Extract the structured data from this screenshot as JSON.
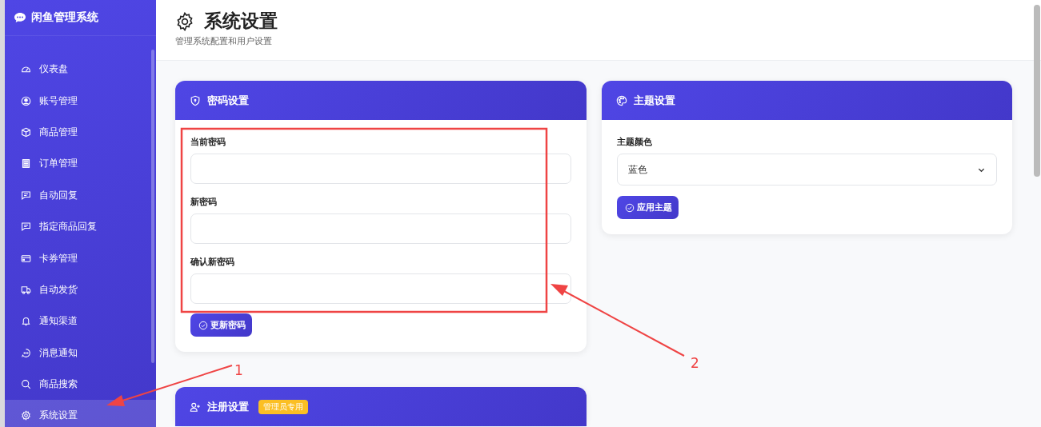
{
  "sidebar": {
    "title": "闲鱼管理系统",
    "items": [
      {
        "label": "仪表盘",
        "kind": "gauge",
        "selected": false
      },
      {
        "label": "账号管理",
        "kind": "user",
        "selected": false
      },
      {
        "label": "商品管理",
        "kind": "box",
        "selected": false
      },
      {
        "label": "订单管理",
        "kind": "receipt",
        "selected": false
      },
      {
        "label": "自动回复",
        "kind": "chat",
        "selected": false
      },
      {
        "label": "指定商品回复",
        "kind": "chat",
        "selected": false
      },
      {
        "label": "卡券管理",
        "kind": "card",
        "selected": false
      },
      {
        "label": "自动发货",
        "kind": "truck",
        "selected": false
      },
      {
        "label": "通知渠道",
        "kind": "bell",
        "selected": false
      },
      {
        "label": "消息通知",
        "kind": "dots",
        "selected": false
      },
      {
        "label": "商品搜索",
        "kind": "search",
        "selected": false
      },
      {
        "label": "系统设置",
        "kind": "gear",
        "selected": true
      }
    ]
  },
  "header": {
    "title": "系统设置",
    "subtitle": "管理系统配置和用户设置"
  },
  "password_card": {
    "title": "密码设置",
    "fields": [
      {
        "label": "当前密码"
      },
      {
        "label": "新密码"
      },
      {
        "label": "确认新密码"
      }
    ],
    "button": "更新密码"
  },
  "theme_card": {
    "title": "主题设置",
    "field_label": "主题颜色",
    "value": "蓝色",
    "button": "应用主题"
  },
  "register_card": {
    "title": "注册设置",
    "badge": "管理员专用"
  },
  "annotations": [
    {
      "label": "1"
    },
    {
      "label": "2"
    }
  ]
}
